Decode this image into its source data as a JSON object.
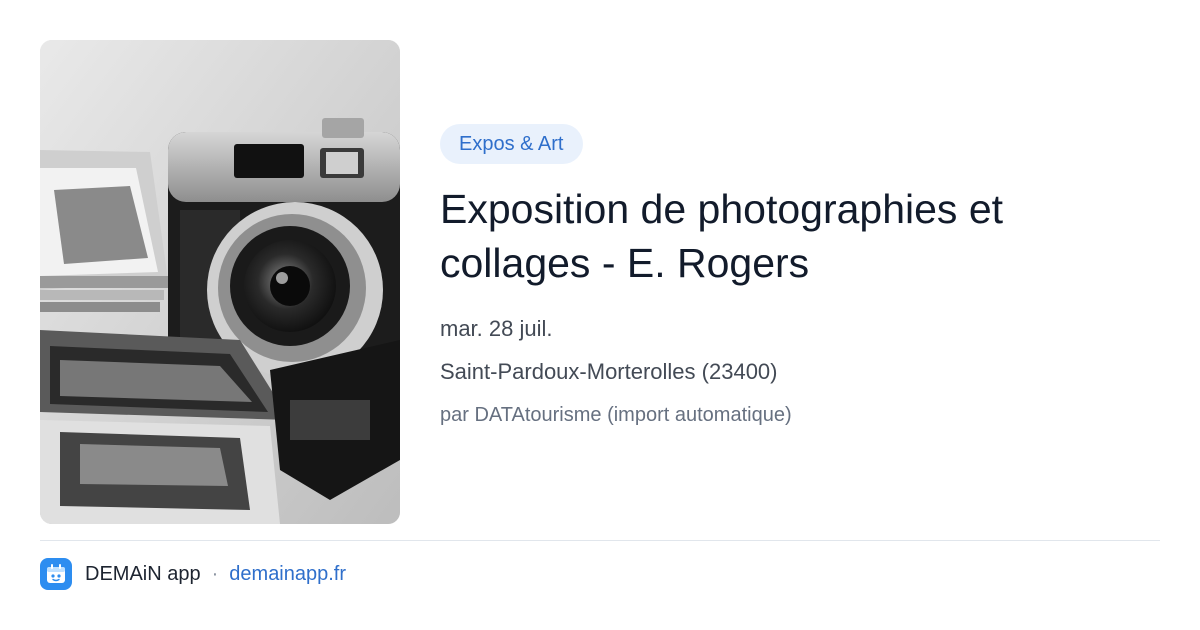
{
  "category": "Expos & Art",
  "event": {
    "title": "Exposition de photographies et collages - E. Rogers",
    "date": "mar. 28 juil.",
    "location": "Saint-Pardoux-Morterolles (23400)",
    "source": "par DATAtourisme (import automatique)"
  },
  "footer": {
    "app_name": "DEMAiN app",
    "separator": "·",
    "domain": "demainapp.fr"
  },
  "colors": {
    "accent": "#2f6fcb",
    "badge_bg": "#e9f1fc",
    "title": "#121b2b",
    "app_icon": "#2d8df0"
  },
  "icons": {
    "app": "demain-app-icon"
  }
}
